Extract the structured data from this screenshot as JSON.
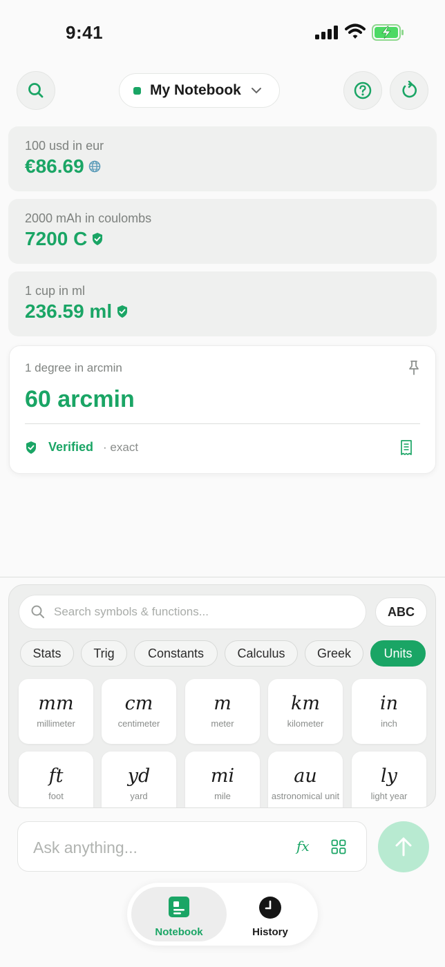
{
  "status_bar": {
    "time": "9:41"
  },
  "header": {
    "notebook_title": "My Notebook"
  },
  "results": [
    {
      "query": "100 usd in eur",
      "value": "€86.69",
      "badge": "globe-icon"
    },
    {
      "query": "2000 mAh in coulombs",
      "value": "7200 C",
      "badge": "verified-shield-icon"
    },
    {
      "query": "1 cup in ml",
      "value": "236.59 ml",
      "badge": "verified-shield-icon"
    }
  ],
  "active_result": {
    "query": "1 degree in arcmin",
    "value": "60 arcmin",
    "status": "Verified",
    "detail": "· exact"
  },
  "keyboard": {
    "search_placeholder": "Search symbols & functions...",
    "abc_label": "ABC",
    "categories": [
      "Stats",
      "Trig",
      "Constants",
      "Calculus",
      "Greek",
      "Units"
    ],
    "selected_category": "Units",
    "keys": [
      {
        "symbol": "mm",
        "name": "millimeter"
      },
      {
        "symbol": "cm",
        "name": "centimeter"
      },
      {
        "symbol": "m",
        "name": "meter"
      },
      {
        "symbol": "km",
        "name": "kilometer"
      },
      {
        "symbol": "in",
        "name": "inch"
      },
      {
        "symbol": "ft",
        "name": "foot"
      },
      {
        "symbol": "yd",
        "name": "yard"
      },
      {
        "symbol": "mi",
        "name": "mile"
      },
      {
        "symbol": "au",
        "name": "astronomical unit"
      },
      {
        "symbol": "ly",
        "name": "light year"
      }
    ]
  },
  "input": {
    "placeholder": "Ask anything...",
    "fx_label": "𝑓x"
  },
  "tabs": [
    {
      "label": "Notebook",
      "active": true
    },
    {
      "label": "History",
      "active": false
    }
  ],
  "colors": {
    "accent": "#1aa565",
    "send_button": "#b8ead1"
  }
}
